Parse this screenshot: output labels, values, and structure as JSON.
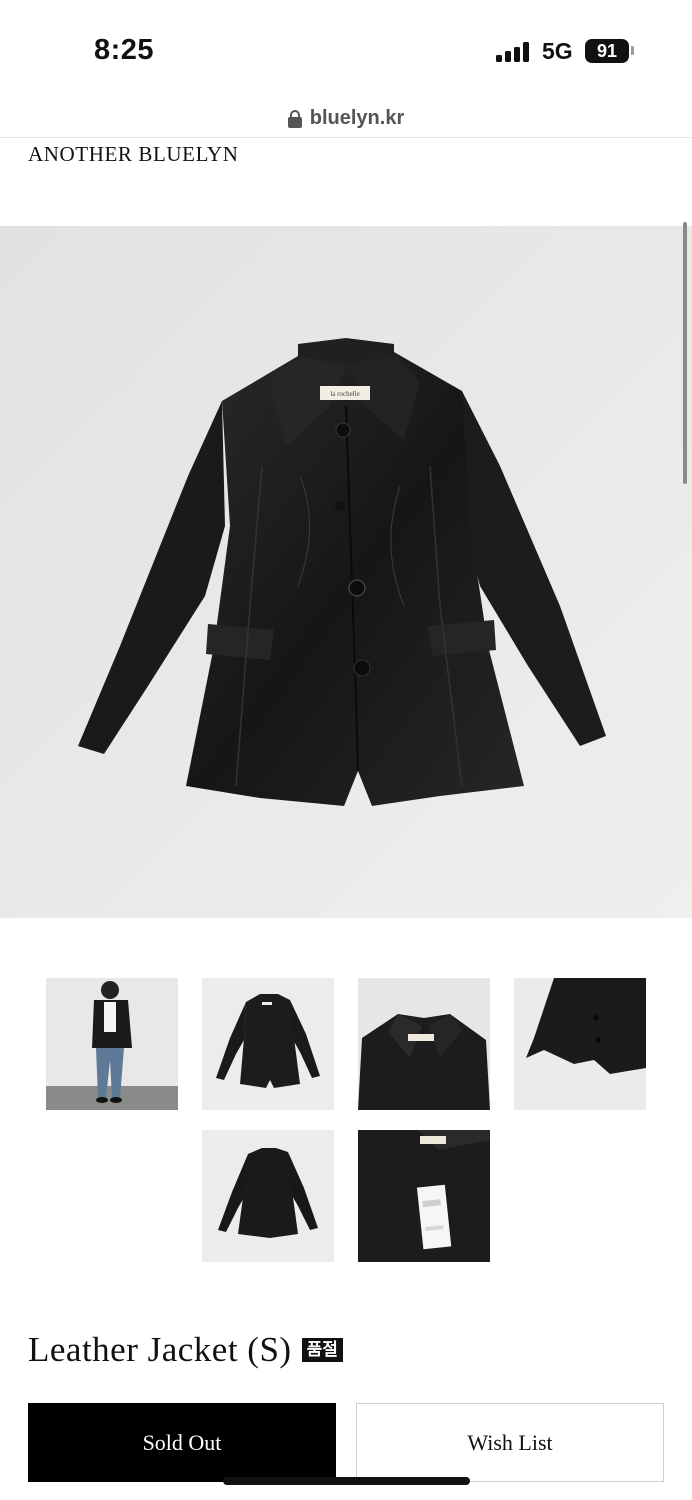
{
  "status_bar": {
    "time": "8:25",
    "network": "5G",
    "battery": "91",
    "signal_icon": "cellular-signal-icon",
    "battery_icon": "battery-icon"
  },
  "browser": {
    "url": "bluelyn.kr",
    "lock_icon": "lock-icon"
  },
  "brand": {
    "name": "ANOTHER BLUELYN"
  },
  "product": {
    "title": "Leather Jacket (S)",
    "badge": "품절",
    "main_image_alt": "black-leather-jacket-photo",
    "thumbnails": [
      {
        "name": "thumb-model-wearing"
      },
      {
        "name": "thumb-jacket-front"
      },
      {
        "name": "thumb-collar-detail"
      },
      {
        "name": "thumb-side-detail"
      },
      {
        "name": "thumb-jacket-back"
      },
      {
        "name": "thumb-tag-detail"
      }
    ],
    "label_tag_text": "la rochelle"
  },
  "actions": {
    "sold_out_label": "Sold Out",
    "wish_list_label": "Wish List"
  },
  "colors": {
    "background": "#ffffff",
    "primary_button": "#000000",
    "photo_backdrop": "#e9e9e7",
    "leather": "#1b1b1b"
  }
}
